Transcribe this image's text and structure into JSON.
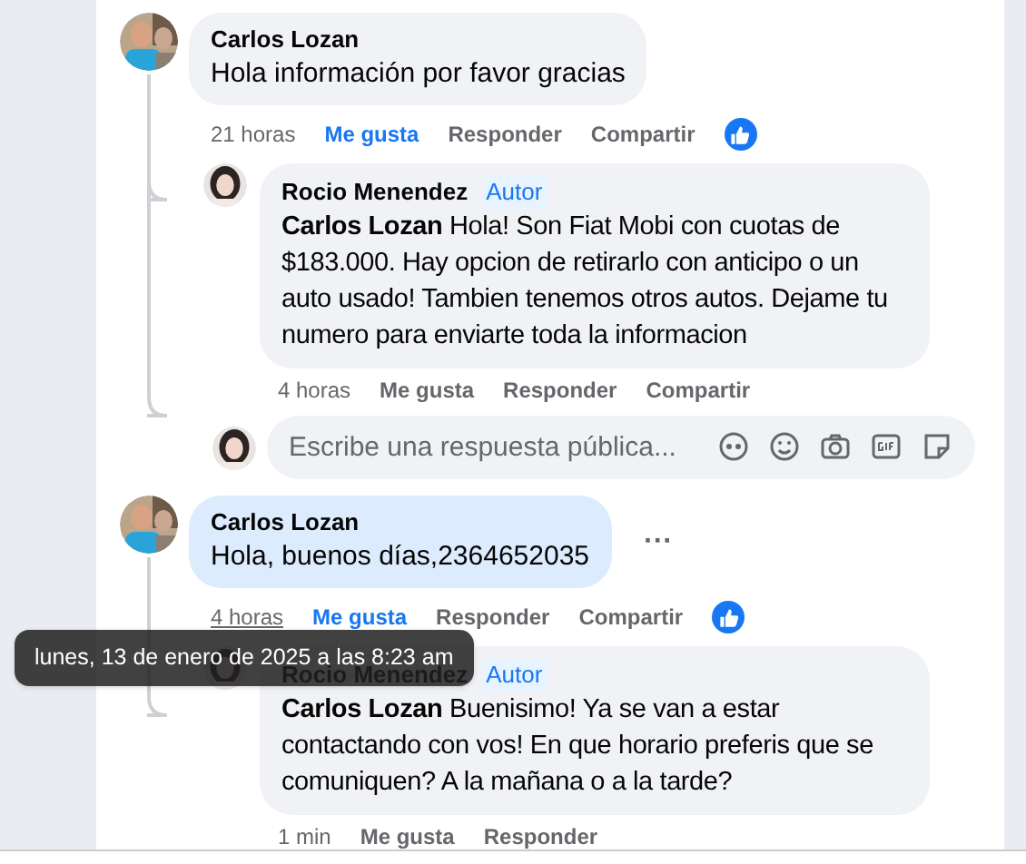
{
  "comments": [
    {
      "author": "Carlos Lozan",
      "text": "Hola información por favor gracias",
      "highlighted": false,
      "time": "21 horas",
      "time_hovered": false,
      "reaction_icon": true,
      "actions": [
        {
          "label": "Me gusta",
          "selected": true
        },
        {
          "label": "Responder",
          "selected": false
        },
        {
          "label": "Compartir",
          "selected": false
        }
      ],
      "replies": [
        {
          "author": "Rocio Menendez",
          "badge": "Autor",
          "mention": "Carlos Lozan",
          "text": "Hola! Son Fiat Mobi con cuotas de $183.000. Hay opcion de retirarlo con anticipo o un auto usado! Tambien tenemos otros autos. Dejame tu numero para enviarte toda la informacion",
          "time": "4 horas",
          "actions": [
            {
              "label": "Me gusta",
              "selected": false
            },
            {
              "label": "Responder",
              "selected": false
            },
            {
              "label": "Compartir",
              "selected": false
            }
          ]
        }
      ],
      "reply_box": {
        "placeholder": "Escribe una respuesta pública..."
      }
    },
    {
      "author": "Carlos Lozan",
      "text": "Hola, buenos días,2364652035",
      "highlighted": true,
      "more": "···",
      "time": "4 horas",
      "time_hovered": true,
      "reaction_icon": true,
      "actions": [
        {
          "label": "Me gusta",
          "selected": true
        },
        {
          "label": "Responder",
          "selected": false
        },
        {
          "label": "Compartir",
          "selected": false
        }
      ],
      "replies": [
        {
          "author": "Rocio Menendez",
          "badge": "Autor",
          "mention": "Carlos Lozan",
          "text": "Buenisimo! Ya se van a estar contactando con vos! En que horario preferis que se comuniquen? A la mañana o a la tarde?",
          "time": "1 min",
          "actions": [
            {
              "label": "Me gusta",
              "selected": false
            },
            {
              "label": "Responder",
              "selected": false
            }
          ]
        }
      ]
    }
  ],
  "tooltip": {
    "text": "lunes, 13 de enero de 2025 a las 8:23 am"
  }
}
